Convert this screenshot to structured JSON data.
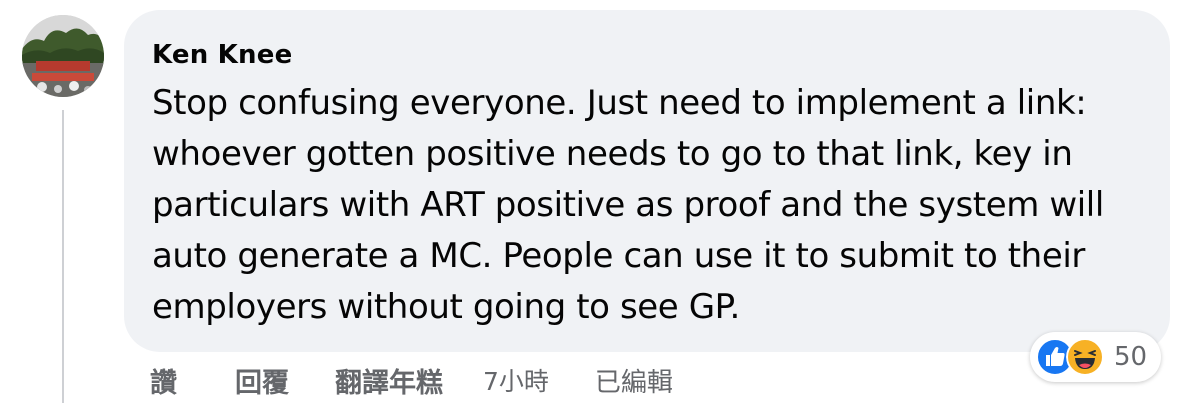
{
  "comment": {
    "author": "Ken Knee",
    "text": "Stop confusing everyone. Just need to implement a link: whoever gotten positive needs to go to that link, key in particulars with ART positive as proof and the system will auto generate a MC. People can use it to submit to their employers without going to see GP.",
    "avatar_icon": "profile-photo"
  },
  "reactions": {
    "icons": [
      "like-icon",
      "haha-icon"
    ],
    "count": "50",
    "colors": {
      "like": "#1877f2",
      "haha": "#f7b125"
    }
  },
  "actions": {
    "like": "讚",
    "reply": "回覆",
    "translate": "翻譯年糕",
    "time": "7小時",
    "edited": "已編輯"
  },
  "colors": {
    "bubble": "#f0f2f5",
    "text": "#050505",
    "secondary_text": "#65676b",
    "thread_line": "#ced0d4"
  }
}
